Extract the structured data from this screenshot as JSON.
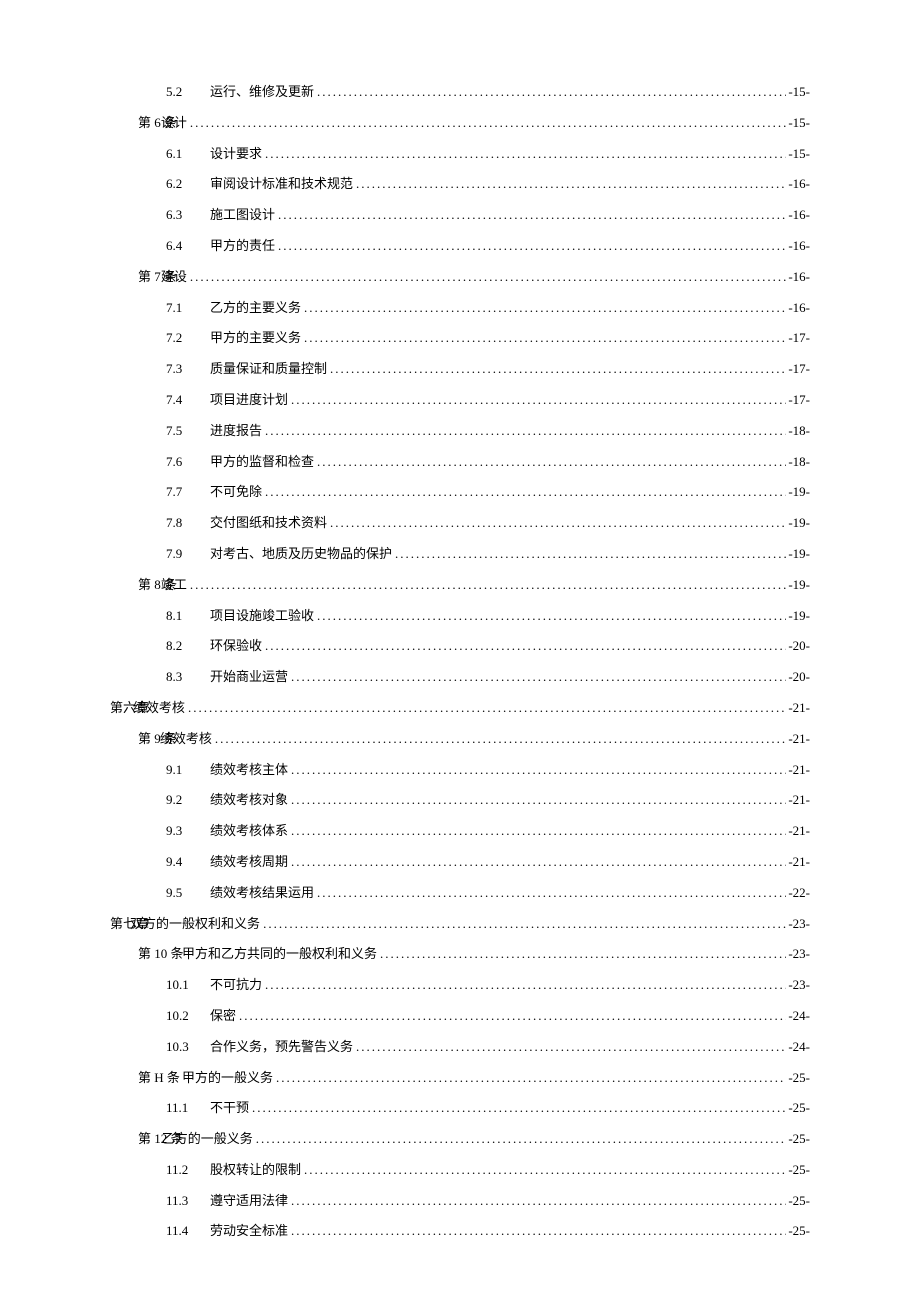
{
  "toc": [
    {
      "indent": 2,
      "num": "5.2",
      "title": "运行、维修及更新",
      "page": "-15-",
      "numWide": false
    },
    {
      "indent": 1,
      "num": "第 6 条",
      "title": "设计",
      "page": "-15-",
      "numWide": true
    },
    {
      "indent": 2,
      "num": "6.1",
      "title": "设计要求",
      "page": "-15-",
      "numWide": false
    },
    {
      "indent": 2,
      "num": "6.2",
      "title": "审阅设计标准和技术规范",
      "page": "-16-",
      "numWide": false
    },
    {
      "indent": 2,
      "num": "6.3",
      "title": "施工图设计",
      "page": "-16-",
      "numWide": false
    },
    {
      "indent": 2,
      "num": "6.4",
      "title": "甲方的责任",
      "page": "-16-",
      "numWide": false
    },
    {
      "indent": 1,
      "num": "第 7 条",
      "title": "建设",
      "page": "-16-",
      "numWide": true
    },
    {
      "indent": 2,
      "num": "7.1",
      "title": "乙方的主要义务",
      "page": "-16-",
      "numWide": false
    },
    {
      "indent": 2,
      "num": "7.2",
      "title": "甲方的主要义务",
      "page": "-17-",
      "numWide": false
    },
    {
      "indent": 2,
      "num": "7.3",
      "title": "质量保证和质量控制",
      "page": "-17-",
      "numWide": false
    },
    {
      "indent": 2,
      "num": "7.4",
      "title": "项目进度计划",
      "page": "-17-",
      "numWide": false
    },
    {
      "indent": 2,
      "num": "7.5",
      "title": "进度报告",
      "page": "-18-",
      "numWide": false
    },
    {
      "indent": 2,
      "num": "7.6",
      "title": "甲方的监督和检查",
      "page": "-18-",
      "numWide": false
    },
    {
      "indent": 2,
      "num": "7.7",
      "title": "不可免除",
      "page": "-19-",
      "numWide": false
    },
    {
      "indent": 2,
      "num": "7.8",
      "title": "交付图纸和技术资料",
      "page": "-19-",
      "numWide": false
    },
    {
      "indent": 2,
      "num": "7.9",
      "title": "对考古、地质及历史物品的保护",
      "page": "-19-",
      "numWide": false
    },
    {
      "indent": 1,
      "num": "第 8 条",
      "title": "竣工",
      "page": "-19-",
      "numWide": true
    },
    {
      "indent": 2,
      "num": "8.1",
      "title": "项目设施竣工验收",
      "page": "-19-",
      "numWide": false
    },
    {
      "indent": 2,
      "num": "8.2",
      "title": "环保验收",
      "page": "-20-",
      "numWide": false
    },
    {
      "indent": 2,
      "num": "8.3",
      "title": "开始商业运营",
      "page": "-20-",
      "numWide": false
    },
    {
      "indent": 0,
      "num": "第六章",
      "title": "绩效考核",
      "page": "-21-",
      "numWide": true
    },
    {
      "indent": 1,
      "num": "第 9 条",
      "title": "绩效考核",
      "page": "-21-",
      "numWide": true
    },
    {
      "indent": 2,
      "num": "9.1",
      "title": "绩效考核主体",
      "page": "-21-",
      "numWide": false
    },
    {
      "indent": 2,
      "num": "9.2",
      "title": "绩效考核对象",
      "page": "-21-",
      "numWide": false
    },
    {
      "indent": 2,
      "num": "9.3",
      "title": "绩效考核体系",
      "page": "-21-",
      "numWide": false
    },
    {
      "indent": 2,
      "num": "9.4",
      "title": "绩效考核周期",
      "page": "-21-",
      "numWide": false
    },
    {
      "indent": 2,
      "num": "9.5",
      "title": "绩效考核结果运用",
      "page": "-22-",
      "numWide": false
    },
    {
      "indent": 0,
      "num": "第七章",
      "title": "双方的一般权利和义务",
      "page": "-23-",
      "numWide": true
    },
    {
      "indent": 1,
      "num": "第 10 条",
      "title": "甲方和乙方共同的一般权利和义务",
      "page": "-23-",
      "numWide": false
    },
    {
      "indent": 2,
      "num": "10.1",
      "title": "不可抗力",
      "page": "-23-",
      "numWide": false
    },
    {
      "indent": 2,
      "num": "10.2",
      "title": "保密",
      "page": "-24-",
      "numWide": false
    },
    {
      "indent": 2,
      "num": "10.3",
      "title": "合作义务，预先警告义务",
      "page": "-24-",
      "numWide": false
    },
    {
      "indent": 1,
      "num": "第 H 条",
      "title": "甲方的一般义务",
      "page": "-25-",
      "numWide": false
    },
    {
      "indent": 2,
      "num": "11.1",
      "title": "不干预",
      "page": "-25-",
      "numWide": false
    },
    {
      "indent": 1,
      "num": "第 12 条",
      "title": "乙方的一般义务",
      "page": "-25-",
      "numWide": true
    },
    {
      "indent": 2,
      "num": "11.2",
      "title": "股权转让的限制",
      "page": "-25-",
      "numWide": false
    },
    {
      "indent": 2,
      "num": "11.3",
      "title": "遵守适用法律",
      "page": "-25-",
      "numWide": false
    },
    {
      "indent": 2,
      "num": "11.4",
      "title": "劳动安全标准",
      "page": "-25-",
      "numWide": false
    }
  ]
}
